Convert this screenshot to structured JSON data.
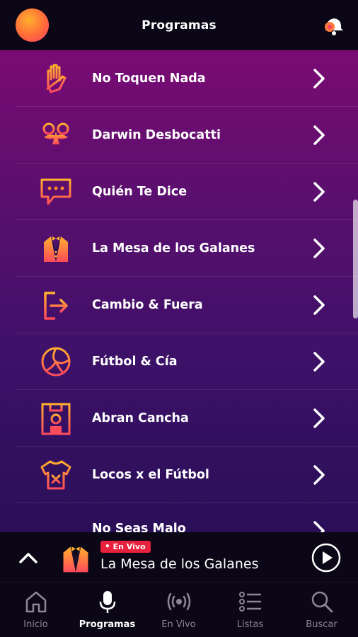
{
  "header": {
    "title": "Programas"
  },
  "programs": [
    {
      "label": "No Toquen Nada",
      "icon": "hand-icon"
    },
    {
      "label": "Darwin Desbocatti",
      "icon": "mustache-glasses-icon"
    },
    {
      "label": "Quién Te Dice",
      "icon": "chat-bubble-icon"
    },
    {
      "label": "La Mesa de los Galanes",
      "icon": "tuxedo-icon"
    },
    {
      "label": "Cambio & Fuera",
      "icon": "exit-arrow-icon"
    },
    {
      "label": "Fútbol & Cía",
      "icon": "volleyball-icon"
    },
    {
      "label": "Abran Cancha",
      "icon": "field-icon"
    },
    {
      "label": "Locos x el Fútbol",
      "icon": "jersey-icon"
    },
    {
      "label": "No Seas Malo",
      "icon": "chevron-right-icon"
    }
  ],
  "player": {
    "badge": "En Vivo",
    "badge_dot": "•",
    "title": "La Mesa de los Galanes",
    "badge_color": "#e8213e"
  },
  "tabs": [
    {
      "label": "Inicio",
      "icon": "home-icon",
      "active": false
    },
    {
      "label": "Programas",
      "icon": "microphone-icon",
      "active": true
    },
    {
      "label": "En Vivo",
      "icon": "broadcast-icon",
      "active": false
    },
    {
      "label": "Listas",
      "icon": "list-icon",
      "active": false
    },
    {
      "label": "Buscar",
      "icon": "search-icon",
      "active": false
    }
  ],
  "colors": {
    "accent_orange": "#ff8a2a",
    "accent_pink": "#ff3f6c",
    "list_top": "#7a0b74",
    "list_bottom": "#2a0f58",
    "bar_bg": "#0b0716"
  }
}
